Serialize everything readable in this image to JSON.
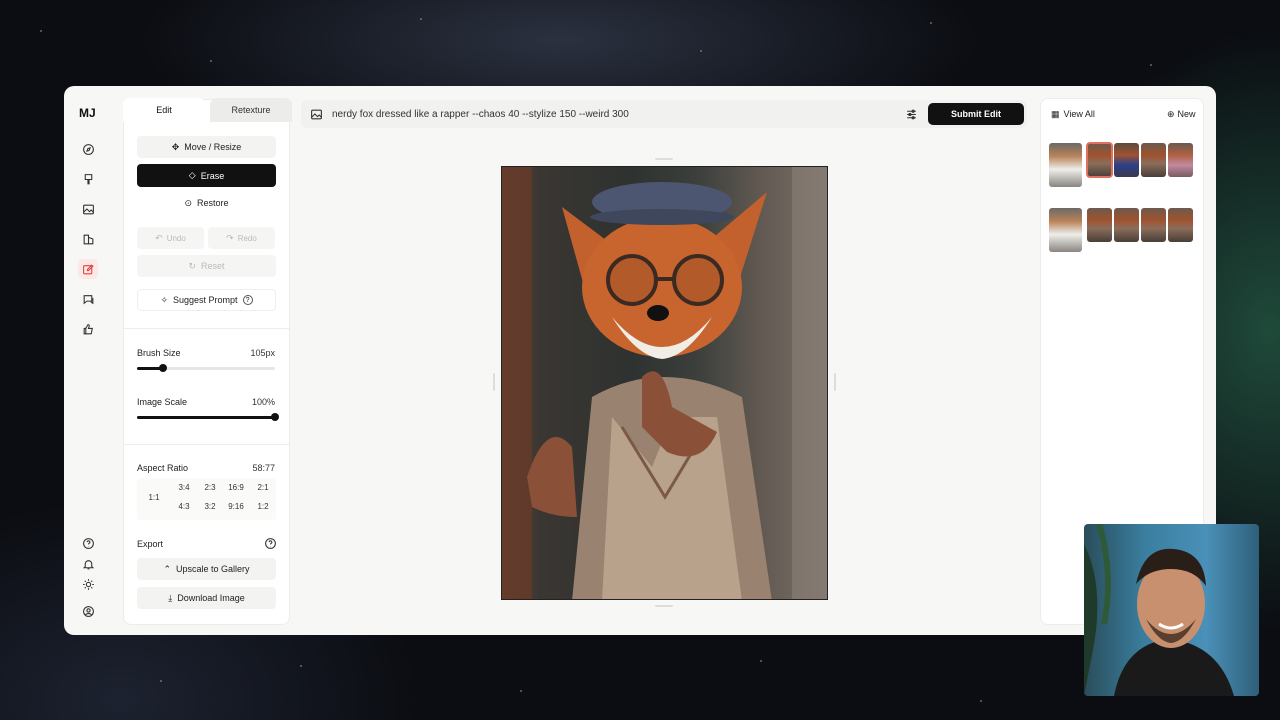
{
  "app": {
    "logo": "MJ"
  },
  "rail": {
    "icons": [
      "compass-icon",
      "brush-icon",
      "image-icon",
      "layers-icon",
      "edit-icon",
      "chat-icon",
      "thumbs-up-icon"
    ],
    "bottom_icons": [
      "help-icon",
      "bell-icon",
      "sun-icon",
      "user-icon"
    ],
    "active": "edit-icon"
  },
  "tabs": {
    "edit": "Edit",
    "retexture": "Retexture"
  },
  "tools": {
    "move_resize": "Move / Resize",
    "erase": "Erase",
    "restore": "Restore",
    "undo": "Undo",
    "redo": "Redo",
    "reset": "Reset",
    "suggest_prompt": "Suggest Prompt"
  },
  "brush": {
    "label": "Brush Size",
    "value": "105px",
    "level": 0.19
  },
  "scale": {
    "label": "Image Scale",
    "value": "100%",
    "level": 1.0
  },
  "aspect": {
    "label": "Aspect Ratio",
    "value": "58:77",
    "square": "1:1",
    "row1": [
      "3:4",
      "2:3",
      "16:9",
      "2:1"
    ],
    "row2": [
      "4:3",
      "3:2",
      "9:16",
      "1:2"
    ]
  },
  "export": {
    "label": "Export",
    "upscale": "Upscale to Gallery",
    "download": "Download Image"
  },
  "prompt": {
    "text": "nerdy fox dressed like a rapper --chaos 40 --stylize 150 --weird 300",
    "submit": "Submit Edit"
  },
  "gallery": {
    "view_all": "View All",
    "new": "New"
  },
  "colors": {
    "accent": "#e0443c",
    "dark": "#111111",
    "panel": "#ffffff",
    "background": "#f7f7f5"
  }
}
